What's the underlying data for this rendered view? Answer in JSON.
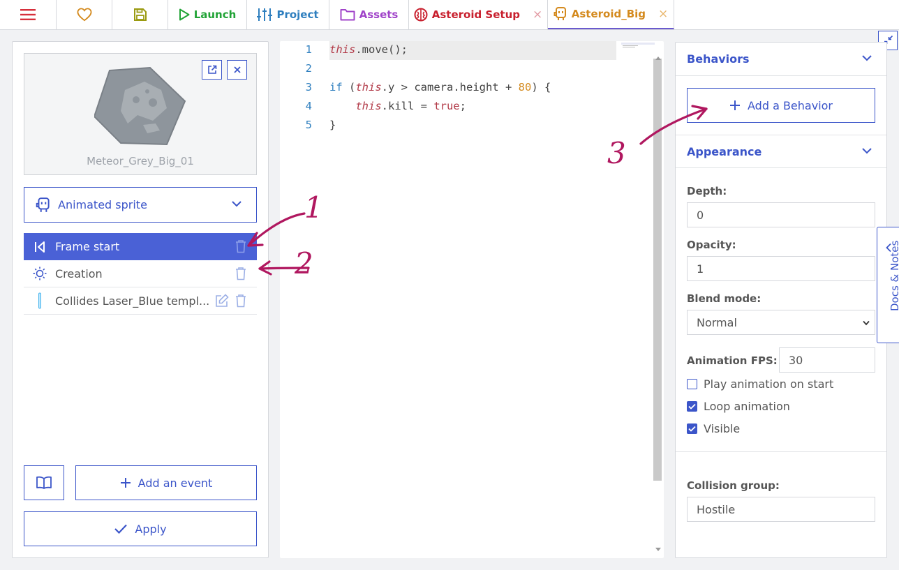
{
  "topbar": {
    "launch": "Launch",
    "project": "Project",
    "assets": "Assets",
    "tab_setup": "Asteroid Setup",
    "tab_big": "Asteroid_Big",
    "close": "×"
  },
  "left": {
    "preview_name": "Meteor_Grey_Big_01",
    "kind_select": "Animated sprite",
    "events": [
      {
        "label": "Frame start"
      },
      {
        "label": "Creation"
      },
      {
        "label": "Collides Laser_Blue templ..."
      }
    ],
    "add_event": "Add an event",
    "apply": "Apply"
  },
  "code": {
    "line_numbers": [
      "1",
      "2",
      "3",
      "4",
      "5"
    ]
  },
  "right": {
    "behaviors_title": "Behaviors",
    "add_behavior": "Add a Behavior",
    "appearance_title": "Appearance",
    "depth_label": "Depth:",
    "depth_value": "0",
    "opacity_label": "Opacity:",
    "opacity_value": "1",
    "blend_label": "Blend mode:",
    "blend_value": "Normal",
    "fps_label": "Animation FPS:",
    "fps_value": "30",
    "play_on_start": "Play animation on start",
    "loop": "Loop animation",
    "visible": "Visible",
    "collision_label": "Collision group:",
    "collision_value": "Hostile"
  },
  "docs_tab": "Docs & Notes",
  "annotations": [
    "1",
    "2",
    "3"
  ],
  "colors": {
    "accent": "#3b55c9",
    "selected_row": "#4a61d6",
    "launch": "#21a336",
    "assets": "#a043c9",
    "setup_tab": "#c8202e",
    "big_tab": "#d48a1e",
    "annotation": "#b0175f"
  }
}
